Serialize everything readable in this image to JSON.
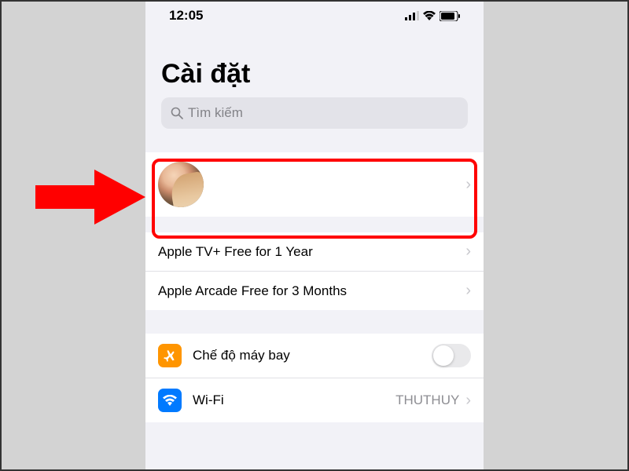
{
  "status": {
    "time": "12:05"
  },
  "header": {
    "title": "Cài đặt"
  },
  "search": {
    "placeholder": "Tìm kiếm"
  },
  "promos": {
    "items": [
      {
        "label": "Apple TV+ Free for 1 Year"
      },
      {
        "label": "Apple Arcade Free for 3 Months"
      }
    ]
  },
  "settings": {
    "items": [
      {
        "label": "Chế độ máy bay",
        "type": "toggle",
        "on": false
      },
      {
        "label": "Wi-Fi",
        "value": "THUTHUY",
        "type": "link"
      }
    ]
  }
}
